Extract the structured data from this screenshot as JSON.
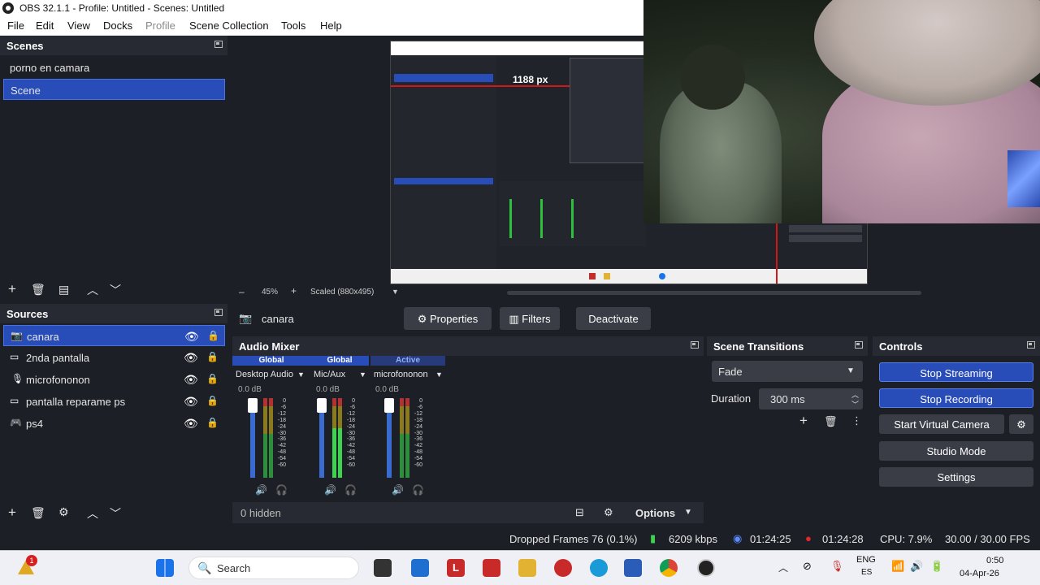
{
  "window": {
    "title": "OBS 32.1.1 - Profile: Untitled - Scenes: Untitled"
  },
  "menu": [
    "File",
    "Edit",
    "View",
    "Docks",
    "Profile",
    "Scene Collection",
    "Tools",
    "Help"
  ],
  "scenes": {
    "title": "Scenes",
    "items": [
      {
        "label": "porno en camara",
        "selected": false
      },
      {
        "label": "Scene",
        "selected": true
      }
    ]
  },
  "preview": {
    "measure_label": "1188 px",
    "zoom": "45%",
    "scaled": "Scaled (880x495)"
  },
  "sources": {
    "title": "Sources",
    "items": [
      {
        "label": "canara",
        "icon": "camera-icon",
        "selected": true
      },
      {
        "label": "2nda pantalla",
        "icon": "monitor-icon",
        "selected": false
      },
      {
        "label": "microfononon",
        "icon": "mic-icon",
        "selected": false
      },
      {
        "label": "pantalla reparame ps",
        "icon": "monitor-icon",
        "selected": false
      },
      {
        "label": "ps4",
        "icon": "gamepad-icon",
        "selected": false
      }
    ]
  },
  "source_toolbar": {
    "name": "canara",
    "properties": "Properties",
    "filters": "Filters",
    "deactivate": "Deactivate"
  },
  "mixer": {
    "title": "Audio Mixer",
    "channels": [
      {
        "tag": "Global",
        "name": "Desktop Audio",
        "db": "0.0 dB",
        "level": 0.75
      },
      {
        "tag": "Global",
        "name": "Mic/Aux",
        "db": "0.0 dB",
        "level": 0.75
      },
      {
        "tag": "Active",
        "name": "microfononon",
        "db": "0.0 dB",
        "level": 0.75
      }
    ],
    "scale": [
      "0",
      "-6",
      "-12",
      "-18",
      "-24",
      "-30",
      "-36",
      "-42",
      "-48",
      "-54",
      "-60"
    ],
    "hidden": "0 hidden",
    "options": "Options"
  },
  "transitions": {
    "title": "Scene Transitions",
    "selected": "Fade",
    "duration_label": "Duration",
    "duration_value": "300 ms"
  },
  "controls": {
    "title": "Controls",
    "stop_streaming": "Stop Streaming",
    "stop_recording": "Stop Recording",
    "virtual_camera": "Start Virtual Camera",
    "studio_mode": "Studio Mode",
    "settings": "Settings"
  },
  "status": {
    "dropped": "Dropped Frames 76 (0.1%)",
    "kbps": "6209 kbps",
    "stream_time": "01:24:25",
    "rec_time": "01:24:28",
    "cpu": "CPU: 7.9%",
    "fps": "30.00 / 30.00 FPS"
  },
  "taskbar": {
    "search": "Search",
    "lang1": "ENG",
    "lang2": "ES",
    "time": "0:50",
    "date": "04-Apr-26",
    "badge": "1"
  },
  "colors": {
    "accent": "#284cb8",
    "panel": "#1d1f26",
    "header": "#272a33"
  }
}
